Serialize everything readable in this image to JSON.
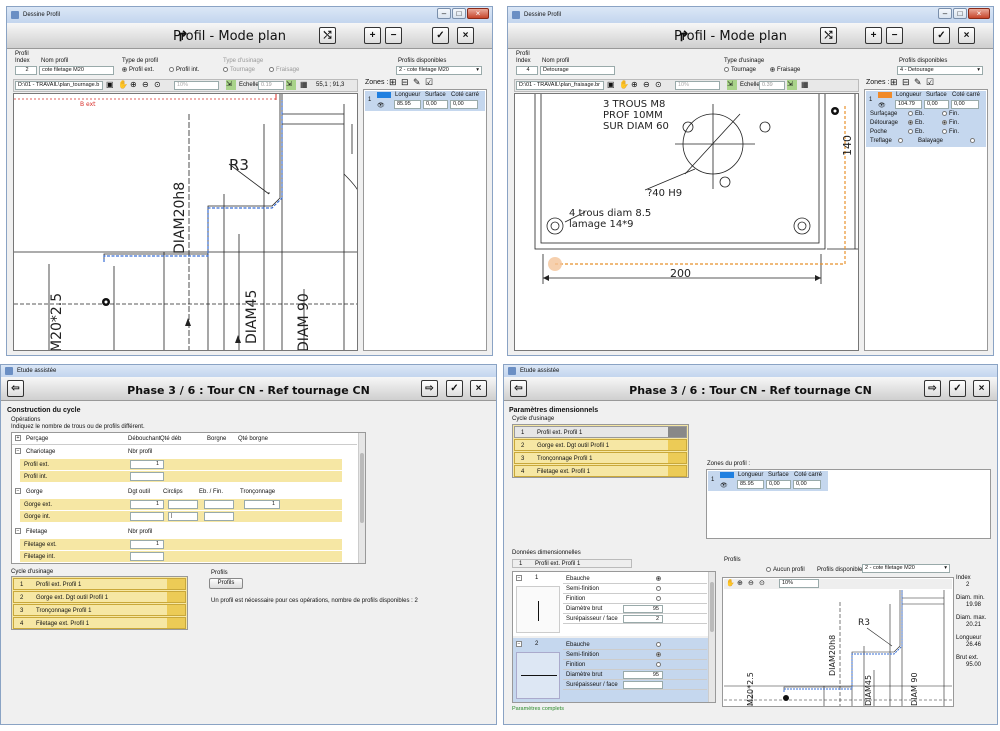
{
  "w1": {
    "window_title": "Dessine Profil",
    "header_title": "Profil - Mode plan",
    "profil_label": "Profil",
    "index_label": "Index",
    "index_value": "2",
    "nom_label": "Nom profil",
    "nom_value": "cote filetage M20",
    "type_label": "Type de profil",
    "type_ext": "Profil ext.",
    "type_int": "Profil int.",
    "usinage_label": "Type d'usinage",
    "tournage": "Tournage",
    "fraisage": "Fraisage",
    "disponibles_label": "Profils disponibles",
    "disponibles_value": "2 - cote filetage M20",
    "file_path": "D:\\01 - TRAVAIL\\plan_tournage.b",
    "zoom": "10%",
    "echelle_label": "Echelle",
    "echelle_value": "0.19",
    "coords": "55,1 ; 91,3",
    "zones_label": "Zones :",
    "zones_headers": [
      "Longueur",
      "Surface",
      "Coté carré"
    ],
    "zones_row": {
      "index": "1",
      "longueur": "85.95",
      "surface": "0,00",
      "cote": "0,00"
    },
    "cad": {
      "r3": "R3",
      "diam20": "DIAM20h8",
      "m20": "M20*2.5",
      "diam45": "DIAM45",
      "diam90": "DIAM 90",
      "bext": "B ext"
    }
  },
  "w2": {
    "window_title": "Dessine Profil",
    "header_title": "Profil - Mode plan",
    "profil_label": "Profil",
    "index_label": "Index",
    "index_value": "4",
    "nom_label": "Nom profil",
    "nom_value": "Detourage",
    "usinage_label": "Type d'usinage",
    "tournage": "Tournage",
    "fraisage": "Fraisage",
    "disponibles_label": "Profils disponibles",
    "disponibles_value": "4 - Detourage",
    "file_path": "D:\\01 - TRAVAIL\\plan_fraisage.br",
    "zoom": "10%",
    "echelle_label": "Echelle",
    "echelle_value": "0.39",
    "zones_label": "Zones :",
    "zones_headers": [
      "Longueur",
      "Surface",
      "Coté carré"
    ],
    "zones_row": {
      "index": "1",
      "longueur": "104.79",
      "surface": "0,00",
      "cote": "0,00"
    },
    "options": [
      {
        "label": "Surfaçage",
        "a": "Eb.",
        "b": "Fin."
      },
      {
        "label": "Détourage",
        "a": "Eb.",
        "b": "Fin."
      },
      {
        "label": "Poche",
        "a": "Eb.",
        "b": "Fin."
      },
      {
        "label": "Treflage",
        "a": "Balayage",
        "b": ""
      }
    ],
    "cad": {
      "l1": "3 TROUS M8",
      "l2": "PROF 10MM",
      "l3": "SUR DIAM 60",
      "l4": "?40 H9",
      "l5": "4 trous diam 8.5",
      "l6": "lamage 14*9",
      "dim200": "200",
      "dim140": "140"
    }
  },
  "w3": {
    "window_title": "Etude assistée",
    "header_title": "Phase 3 / 6 : Tour CN - Ref tournage CN",
    "section_title": "Construction du cycle",
    "ops_label": "Opérations",
    "ops_hint": "Indiquez le nombre de trous ou de profils différent.",
    "groups": [
      {
        "name": "Perçage",
        "cols": [
          "Débouchant",
          "Qté déb",
          "Borgne",
          "Qté borgne"
        ],
        "rows": []
      },
      {
        "name": "Chariotage",
        "cols": [
          "Nbr profil"
        ],
        "rows": [
          {
            "label": "Profil ext.",
            "v": "1"
          },
          {
            "label": "Profil int.",
            "v": ""
          }
        ]
      },
      {
        "name": "Gorge",
        "cols": [
          "Dgt outil",
          "Circlips",
          "Eb. / Fin.",
          "Tronçonnage"
        ],
        "rows": [
          {
            "label": "Gorge ext.",
            "v": "1",
            "t": "1"
          },
          {
            "label": "Gorge int.",
            "v": ""
          }
        ]
      },
      {
        "name": "Filetage",
        "cols": [
          "Nbr profil"
        ],
        "rows": [
          {
            "label": "Filetage ext.",
            "v": "1"
          },
          {
            "label": "Filetage int.",
            "v": ""
          }
        ]
      }
    ],
    "cycle_label": "Cycle d'usinage",
    "cycle": [
      {
        "n": "1",
        "label": "Profil ext. Profil 1"
      },
      {
        "n": "2",
        "label": "Gorge ext. Dgt outil Profil 1"
      },
      {
        "n": "3",
        "label": "Tronçonnage Profil 1"
      },
      {
        "n": "4",
        "label": "Filetage ext. Profil 1"
      }
    ],
    "profils_label": "Profils",
    "profils_button": "Profils",
    "profils_note": "Un profil est nécessaire pour ces opérations, nombre de profils disponibles : 2"
  },
  "w4": {
    "window_title": "Etude assistée",
    "header_title": "Phase 3 / 6 : Tour CN - Ref tournage CN",
    "section_title": "Paramètres dimensionnels",
    "cycle_label": "Cycle d'usinage",
    "cycle": [
      {
        "n": "1",
        "label": "Profil ext. Profil 1"
      },
      {
        "n": "2",
        "label": "Gorge ext. Dgt outil Profil 1"
      },
      {
        "n": "3",
        "label": "Tronçonnage Profil 1"
      },
      {
        "n": "4",
        "label": "Filetage ext. Profil 1"
      }
    ],
    "zones_label": "Zones du profil :",
    "zones_headers": [
      "Longueur",
      "Surface",
      "Coté carré"
    ],
    "zones_row": {
      "index": "1",
      "longueur": "85.95",
      "surface": "0,00",
      "cote": "0,00"
    },
    "donnees_label": "Données dimensionnelles",
    "donnees_sel": {
      "n": "1",
      "label": "Profil ext. Profil 1"
    },
    "blocks": [
      {
        "n": "1",
        "rows": [
          {
            "label": "Ebauche",
            "val": "",
            "radio": true,
            "on": true
          },
          {
            "label": "Semi-finition",
            "val": "",
            "radio": true,
            "on": false
          },
          {
            "label": "Finition",
            "val": "",
            "radio": true,
            "on": false
          },
          {
            "label": "Diamètre brut",
            "val": "95",
            "radio": false
          },
          {
            "label": "Surépaisseur / face",
            "val": "2",
            "radio": false
          }
        ]
      },
      {
        "n": "2",
        "rows": [
          {
            "label": "Ebauche",
            "val": "",
            "radio": true,
            "on": false
          },
          {
            "label": "Semi-finition",
            "val": "",
            "radio": true,
            "on": true
          },
          {
            "label": "Finition",
            "val": "",
            "radio": true,
            "on": false
          },
          {
            "label": "Diamètre brut",
            "val": "95",
            "radio": false
          },
          {
            "label": "Surépaisseur / face",
            "val": "",
            "radio": false
          }
        ]
      }
    ],
    "profils_label": "Profils",
    "aucun": "Aucun profil",
    "disponibles_label": "Profils disponibles",
    "disponibles_value": "2 - cote filetage M20",
    "zoom": "10%",
    "side": [
      {
        "label": "Index",
        "value": "2"
      },
      {
        "label": "Diam. min.",
        "value": "19.98"
      },
      {
        "label": "Diam. max.",
        "value": "20.21"
      },
      {
        "label": "Longueur",
        "value": "26.46"
      },
      {
        "label": "Brut ext.",
        "value": "95.00"
      }
    ],
    "cad": {
      "r3": "R3",
      "diam20": "DIAM20h8",
      "m20": "M20*2.5",
      "diam45": "DIAM45",
      "diam90": "DIAM 90"
    },
    "status": "Paramètres complets"
  }
}
